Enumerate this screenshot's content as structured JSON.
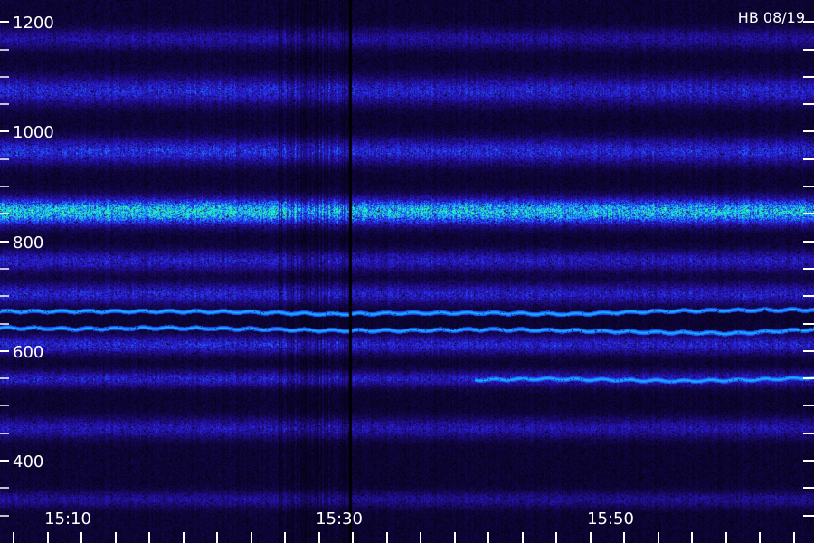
{
  "chart_data": {
    "type": "heatmap",
    "title": "HB 08/19",
    "y_tick_labels": [
      "1200",
      "1000",
      "800",
      "600",
      "400"
    ],
    "y_tick_values": [
      1200,
      1000,
      800,
      600,
      400
    ],
    "y_range": [
      250,
      1240
    ],
    "x_tick_labels": [
      "15:10",
      "15:30",
      "15:50"
    ],
    "x_tick_values_min": [
      10,
      30,
      50
    ],
    "x_range_min": [
      5,
      65
    ],
    "grid": false,
    "colormap": [
      "#000000",
      "#1a0a6a",
      "#2a18d0",
      "#1e5aff",
      "#14c8ff",
      "#2cff9a"
    ],
    "bands": [
      {
        "center": 1170,
        "width": 18,
        "intensity": 0.2
      },
      {
        "center": 1075,
        "width": 24,
        "intensity": 0.32
      },
      {
        "center": 965,
        "width": 22,
        "intensity": 0.35
      },
      {
        "center": 855,
        "width": 22,
        "intensity": 0.75
      },
      {
        "center": 765,
        "width": 18,
        "intensity": 0.28
      },
      {
        "center": 705,
        "width": 18,
        "intensity": 0.3
      },
      {
        "center": 612,
        "width": 16,
        "intensity": 0.32
      },
      {
        "center": 550,
        "width": 14,
        "intensity": 0.28
      },
      {
        "center": 460,
        "width": 18,
        "intensity": 0.24
      },
      {
        "center": 330,
        "width": 14,
        "intensity": 0.18
      }
    ],
    "lines": [
      {
        "start_min": 5,
        "end_min": 65,
        "values": [
          673,
          673,
          673,
          672,
          668,
          670,
          670,
          668,
          673,
          675,
          676
        ]
      },
      {
        "start_min": 5,
        "end_min": 65,
        "values": [
          643,
          641,
          643,
          641,
          638,
          638,
          640,
          638,
          635,
          633,
          640
        ]
      },
      {
        "start_min": 40,
        "end_min": 65,
        "values": [
          548,
          550,
          548,
          546,
          548,
          552
        ]
      }
    ]
  }
}
